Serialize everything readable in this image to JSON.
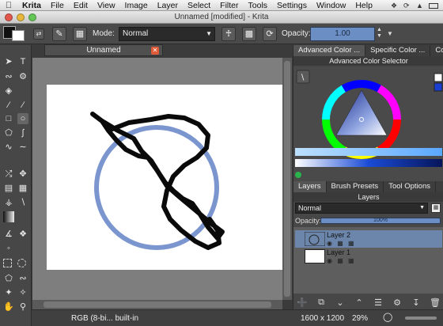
{
  "menubar": {
    "app": "Krita",
    "items": [
      "File",
      "Edit",
      "View",
      "Image",
      "Layer",
      "Select",
      "Filter",
      "Tools",
      "Settings",
      "Window",
      "Help"
    ]
  },
  "window": {
    "title": "Unnamed [modified] - Krita"
  },
  "toolbar": {
    "mode_label": "Mode:",
    "mode_value": "Normal",
    "opacity_label": "Opacity:",
    "opacity_value": "1.00"
  },
  "document": {
    "tab_label": "Unnamed",
    "stroke_color": "#0a0a0a",
    "circle_color": "#7b96cf"
  },
  "dock": {
    "tabs": [
      "Advanced Color ...",
      "Specific Color ...",
      "Colo..."
    ],
    "selector_title": "Advanced Color Selector",
    "layer_tabs": [
      "Layers",
      "Brush Presets",
      "Tool Options"
    ],
    "layers_title": "Layers",
    "blend_mode": "Normal",
    "opacity_label": "Opacity:",
    "opacity_value": "100%",
    "layers": [
      {
        "name": "Layer 2",
        "selected": true
      },
      {
        "name": "Layer 1",
        "selected": false
      }
    ]
  },
  "statusbar": {
    "color_profile": "RGB (8-bi... built-in",
    "dimensions": "1600 x 1200",
    "zoom": "29%"
  },
  "icons": {
    "apple": "apple-icon",
    "close_tab": "close-icon",
    "eyedropper": "eyedropper-icon"
  }
}
